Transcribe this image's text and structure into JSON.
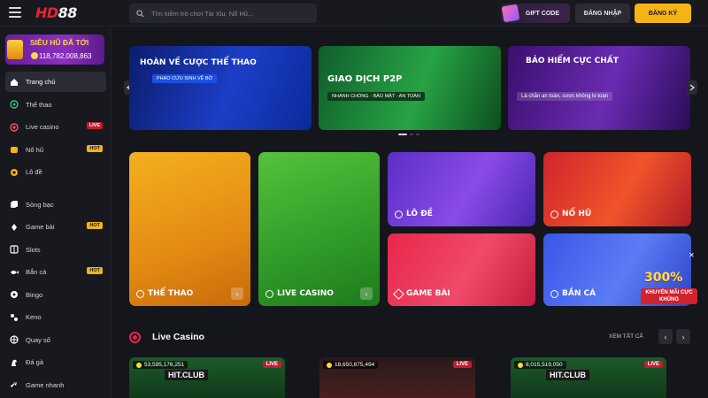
{
  "header": {
    "logo_hd": "HD",
    "logo_88": "88",
    "search_placeholder": "Tìm kiếm trò chơi Tài Xỉu, Nổ Hũ...",
    "gift_code": "GIFT CODE",
    "login": "ĐĂNG NHẬP",
    "register": "ĐĂNG KÝ"
  },
  "jackpot": {
    "title": "SIÊU HŨ ĐÃ TỚI",
    "amount": "118,782,008,863"
  },
  "sidebar": {
    "items": [
      {
        "label": "Trang chủ",
        "icon": "home-icon",
        "badge": ""
      },
      {
        "label": "Thể thao",
        "icon": "soccer-ball-icon",
        "badge": ""
      },
      {
        "label": "Live casino",
        "icon": "live-casino-icon",
        "badge": "LIVE"
      },
      {
        "label": "Nổ hũ",
        "icon": "slot-jar-icon",
        "badge": "HOT"
      },
      {
        "label": "Lô đề",
        "icon": "lottery-ball-icon",
        "badge": ""
      },
      {
        "label": "Sòng bạc",
        "icon": "cards-icon",
        "badge": ""
      },
      {
        "label": "Game bài",
        "icon": "card-game-icon",
        "badge": "HOT"
      },
      {
        "label": "Slots",
        "icon": "slots-icon",
        "badge": ""
      },
      {
        "label": "Bắn cá",
        "icon": "fish-icon",
        "badge": "HOT"
      },
      {
        "label": "Bingo",
        "icon": "bingo-icon",
        "badge": ""
      },
      {
        "label": "Keno",
        "icon": "keno-icon",
        "badge": ""
      },
      {
        "label": "Quay số",
        "icon": "wheel-icon",
        "badge": ""
      },
      {
        "label": "Đá gà",
        "icon": "rooster-icon",
        "badge": ""
      },
      {
        "label": "Game nhanh",
        "icon": "rocket-icon",
        "badge": ""
      }
    ]
  },
  "banners": [
    {
      "title": "HOÀN VỀ CƯỢC THỂ THAO",
      "sub": "PHAO CỨU SINH VỀ BỜ"
    },
    {
      "title": "GIAO DỊCH P2P",
      "sub": "NHANH CHÓNG - BẢO MẬT - AN TOÀN"
    },
    {
      "title": "BẢO HIỂM CỰC CHẤT",
      "sub": "Là chắn an toàn, cược không lo toan"
    }
  ],
  "categories": {
    "sport": "THỂ THAO",
    "live": "LIVE CASINO",
    "lode": "LÔ ĐỀ",
    "nohu": "NỔ HŨ",
    "bai": "GAME BÀI",
    "ca": "BẮN CÁ"
  },
  "promo": {
    "percent": "300%",
    "text": "KHUYẾN MÃI CỰC KHỦNG"
  },
  "live_section": {
    "title": "Live Casino",
    "see_all": "XEM TẤT CẢ",
    "tiles": [
      {
        "amount": "53,595,176,251",
        "tag": "LIVE",
        "brand": "HIT.CLUB"
      },
      {
        "amount": "18,650,875,494",
        "tag": "LIVE",
        "brand": ""
      },
      {
        "amount": "8,015,519,050",
        "tag": "LIVE",
        "brand": "HIT.CLUB"
      }
    ]
  }
}
